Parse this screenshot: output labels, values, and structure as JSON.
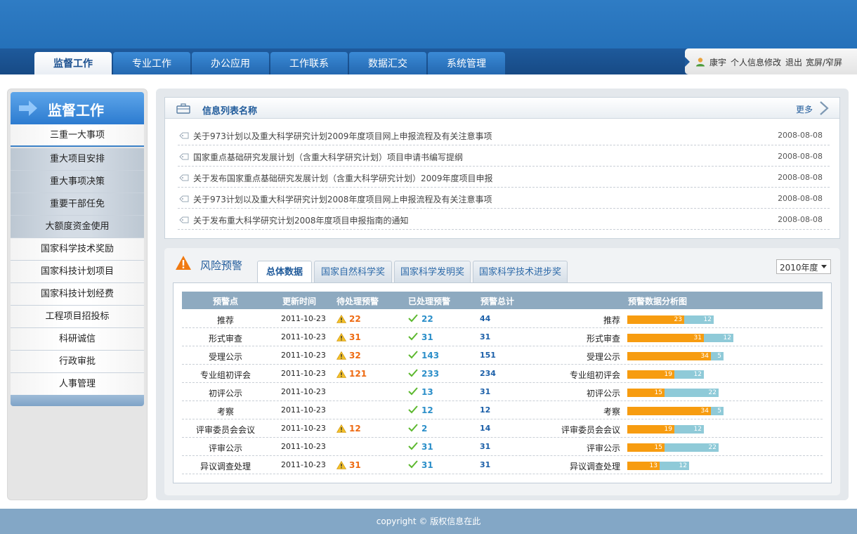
{
  "nav": {
    "tabs": [
      "监督工作",
      "专业工作",
      "办公应用",
      "工作联系",
      "数据汇交",
      "系统管理"
    ],
    "active": 0
  },
  "user": {
    "name": "康宇",
    "links": [
      "个人信息修改",
      "退出",
      "宽屏/窄屏"
    ]
  },
  "sidebar": {
    "title": "监督工作",
    "items": [
      "三重一大事项",
      "重大项目安排",
      "重大事项决策",
      "重要干部任免",
      "大额度资金使用",
      "国家科学技术奖励",
      "国家科技计划项目",
      "国家科技计划经费",
      "工程项目招投标",
      "科研诚信",
      "行政审批",
      "人事管理"
    ]
  },
  "info_list": {
    "title": "信息列表名称",
    "more": "更多",
    "items": [
      {
        "title": "关于973计划以及重大科学研究计划2009年度项目网上申报流程及有关注意事项",
        "date": "2008-08-08"
      },
      {
        "title": "国家重点基础研究发展计划（含重大科学研究计划）项目申请书编写提纲",
        "date": "2008-08-08"
      },
      {
        "title": "关于发布国家重点基础研究发展计划（含重大科学研究计划）2009年度项目申报",
        "date": "2008-08-08"
      },
      {
        "title": "关于973计划以及重大科学研究计划2008年度项目网上申报流程及有关注意事项",
        "date": "2008-08-08"
      },
      {
        "title": "关于发布重大科学研究计划2008年度项目申报指南的通知",
        "date": "2008-08-08"
      }
    ]
  },
  "risk": {
    "title": "风险预警",
    "tabs": [
      "总体数据",
      "国家自然科学奖",
      "国家科学发明奖",
      "国家科学技术进步奖"
    ],
    "year": "2010年度",
    "columns": [
      "预警点",
      "更新时间",
      "待处理预警",
      "已处理预警",
      "预警总计",
      "预警数据分析图"
    ],
    "rows": [
      {
        "name": "推荐",
        "date": "2011-10-23",
        "pending": "22",
        "done": "22",
        "total": "44",
        "bar_pending": 23,
        "bar_done": 12
      },
      {
        "name": "形式审查",
        "date": "2011-10-23",
        "pending": "31",
        "done": "31",
        "total": "31",
        "bar_pending": 31,
        "bar_done": 12
      },
      {
        "name": "受理公示",
        "date": "2011-10-23",
        "pending": "32",
        "done": "143",
        "total": "151",
        "bar_pending": 34,
        "bar_done": 5
      },
      {
        "name": "专业组初评会",
        "date": "2011-10-23",
        "pending": "121",
        "done": "233",
        "total": "234",
        "bar_pending": 19,
        "bar_done": 12
      },
      {
        "name": "初评公示",
        "date": "2011-10-23",
        "pending": "",
        "done": "13",
        "total": "31",
        "bar_pending": 15,
        "bar_done": 22
      },
      {
        "name": "考察",
        "date": "2011-10-23",
        "pending": "",
        "done": "12",
        "total": "12",
        "bar_pending": 34,
        "bar_done": 5
      },
      {
        "name": "评审委员会会议",
        "date": "2011-10-23",
        "pending": "12",
        "done": "2",
        "total": "14",
        "bar_pending": 19,
        "bar_done": 12
      },
      {
        "name": "评审公示",
        "date": "2011-10-23",
        "pending": "",
        "done": "31",
        "total": "31",
        "bar_pending": 15,
        "bar_done": 22
      },
      {
        "name": "异议调查处理",
        "date": "2011-10-23",
        "pending": "31",
        "done": "31",
        "total": "31",
        "bar_pending": 13,
        "bar_done": 12
      }
    ]
  },
  "footer": {
    "text": "copyright © 版权信息在此"
  }
}
